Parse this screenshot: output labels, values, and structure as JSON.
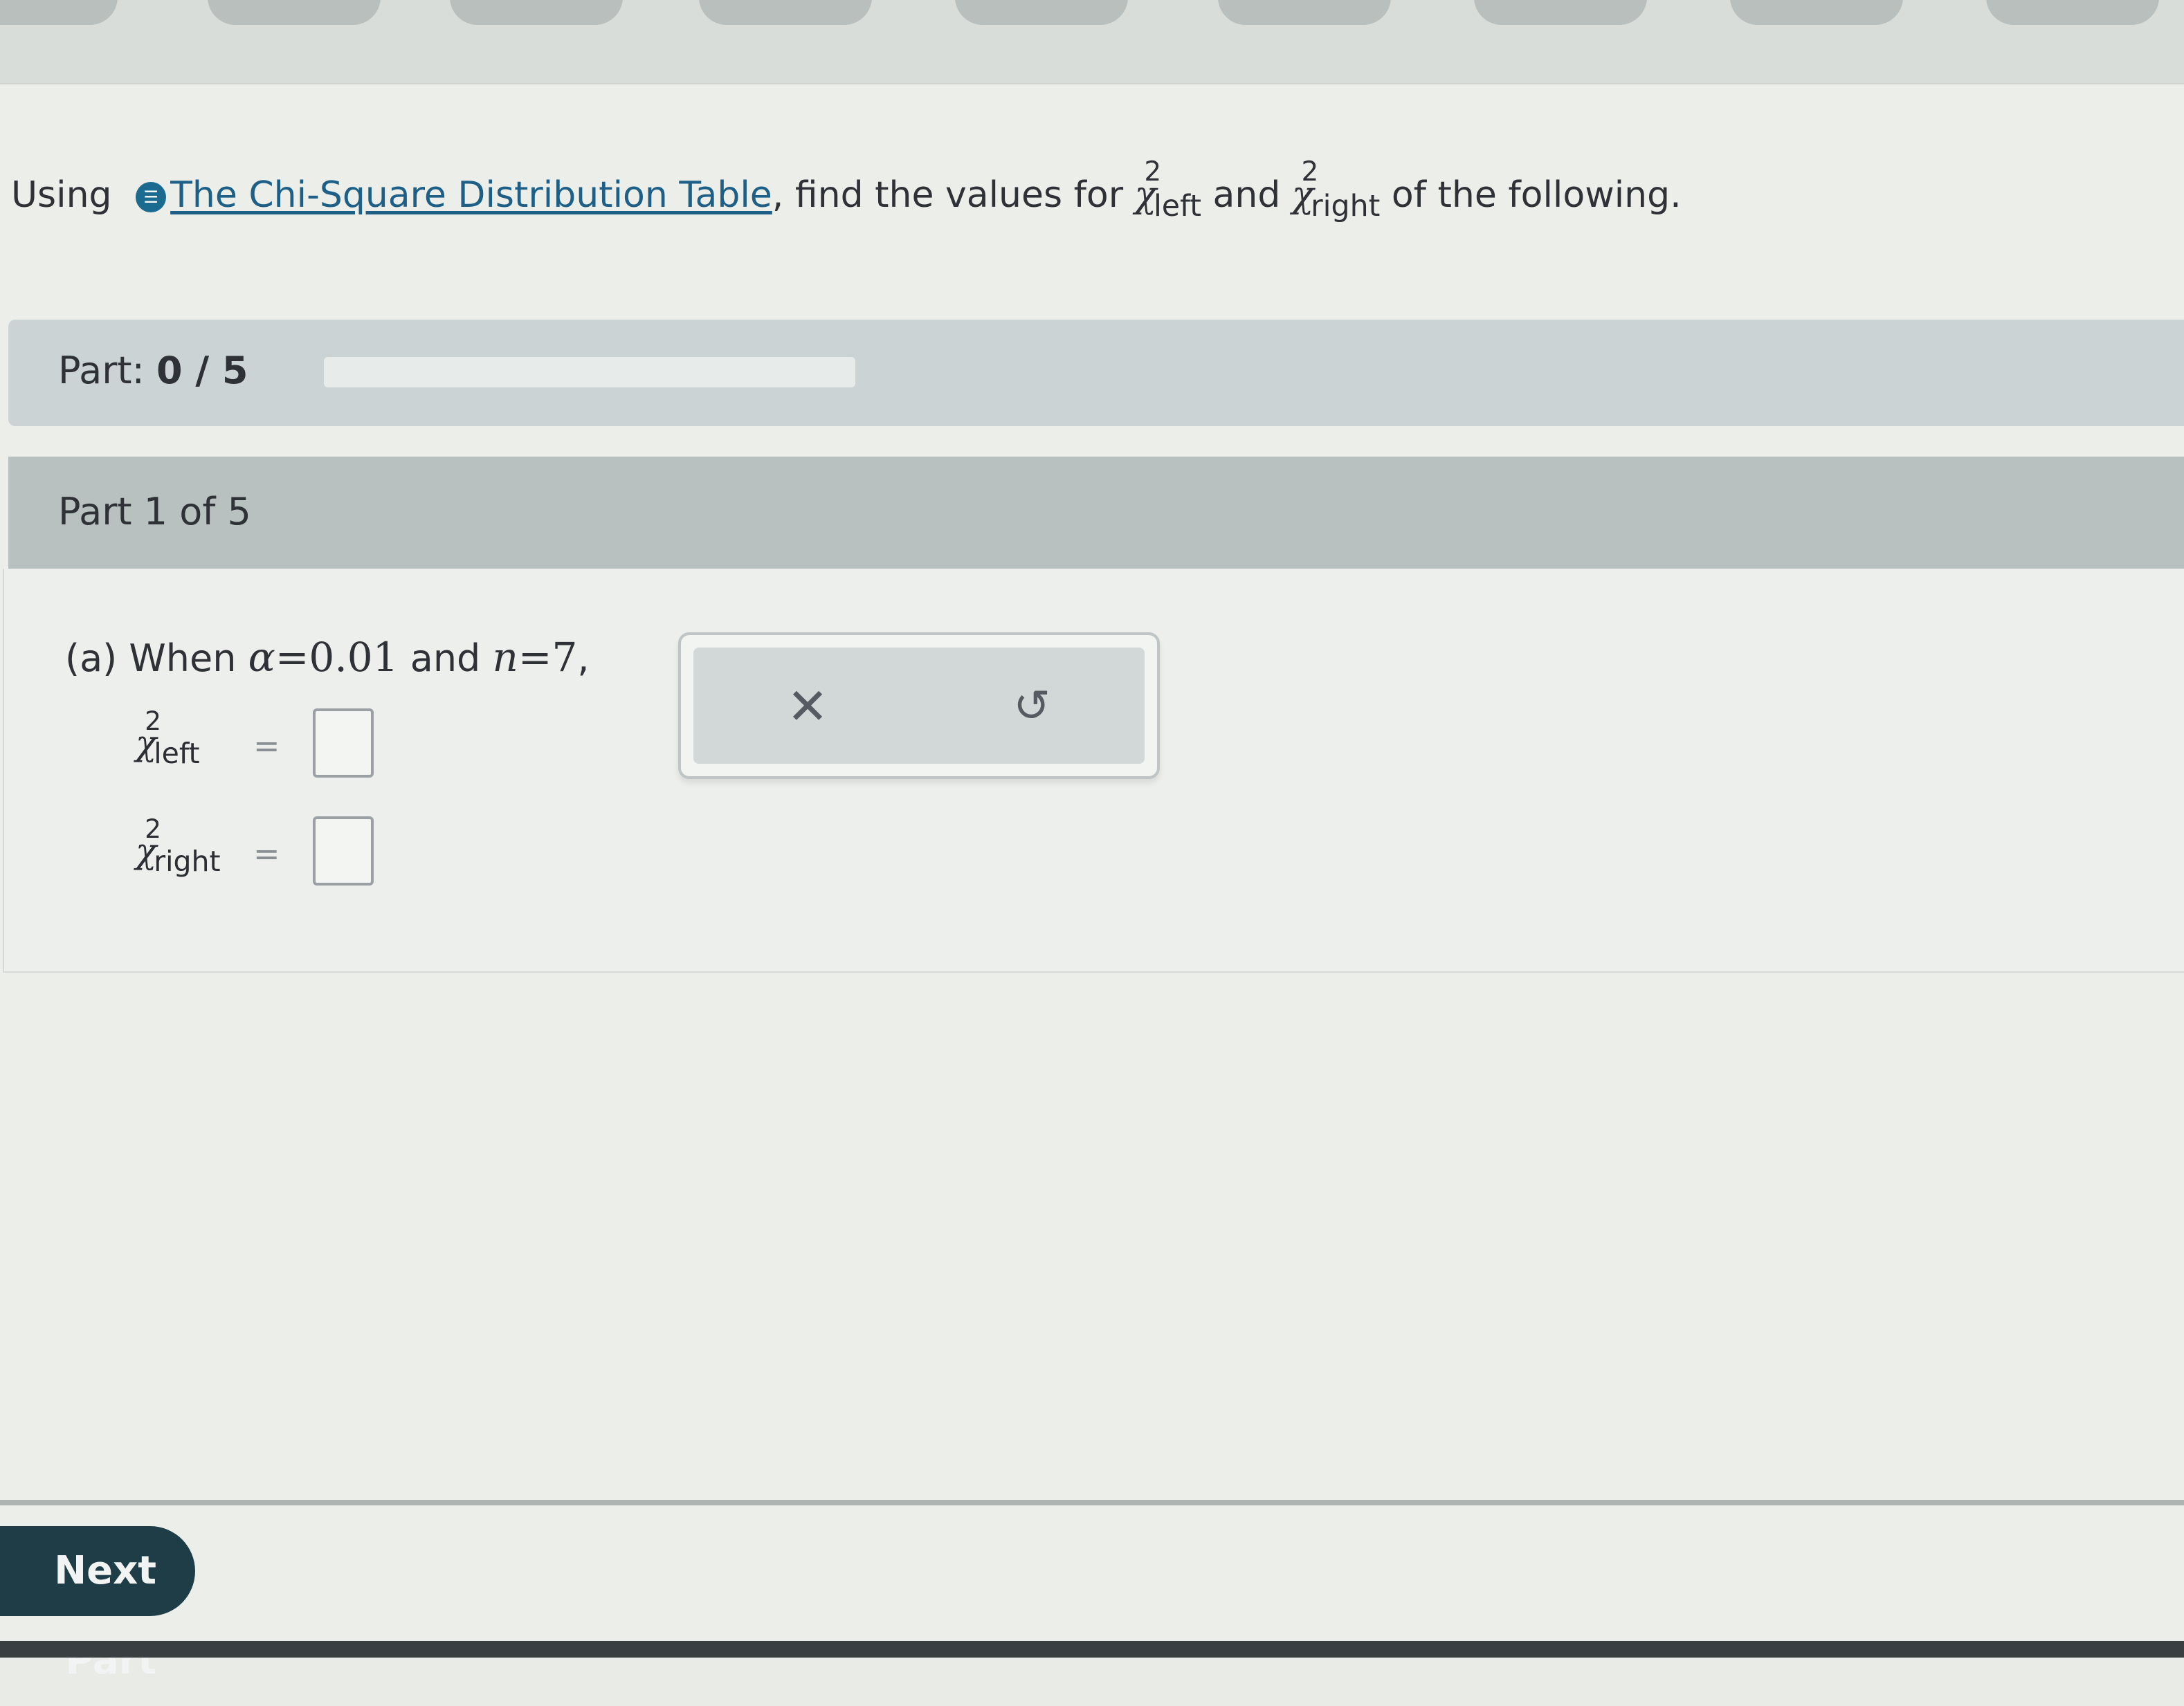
{
  "instruction": {
    "prefix": "Using",
    "info_icon": "info-icon",
    "link_text": "The Chi-Square Distribution Table",
    "middle": ", find the values for",
    "and_text": "and",
    "suffix": "of the following."
  },
  "chi_symbol": "χ",
  "chi_power": "2",
  "chi_left_sub": "left",
  "chi_right_sub": "right",
  "progress": {
    "label": "Part:",
    "value": "0 / 5",
    "fraction": 0
  },
  "part_header": "Part 1 of 5",
  "question": {
    "prefix": "(a) When",
    "alpha_symbol": "α",
    "alpha_eq": "=",
    "alpha_value": "0.01",
    "and_text": "and",
    "n_symbol": "n",
    "n_eq": "=",
    "n_value": "7",
    "trailing": ","
  },
  "answers": {
    "equals": "="
  },
  "tools": {
    "clear_symbol": "✕",
    "undo_symbol": "↺"
  },
  "footer": {
    "next_label": "Next Part"
  }
}
